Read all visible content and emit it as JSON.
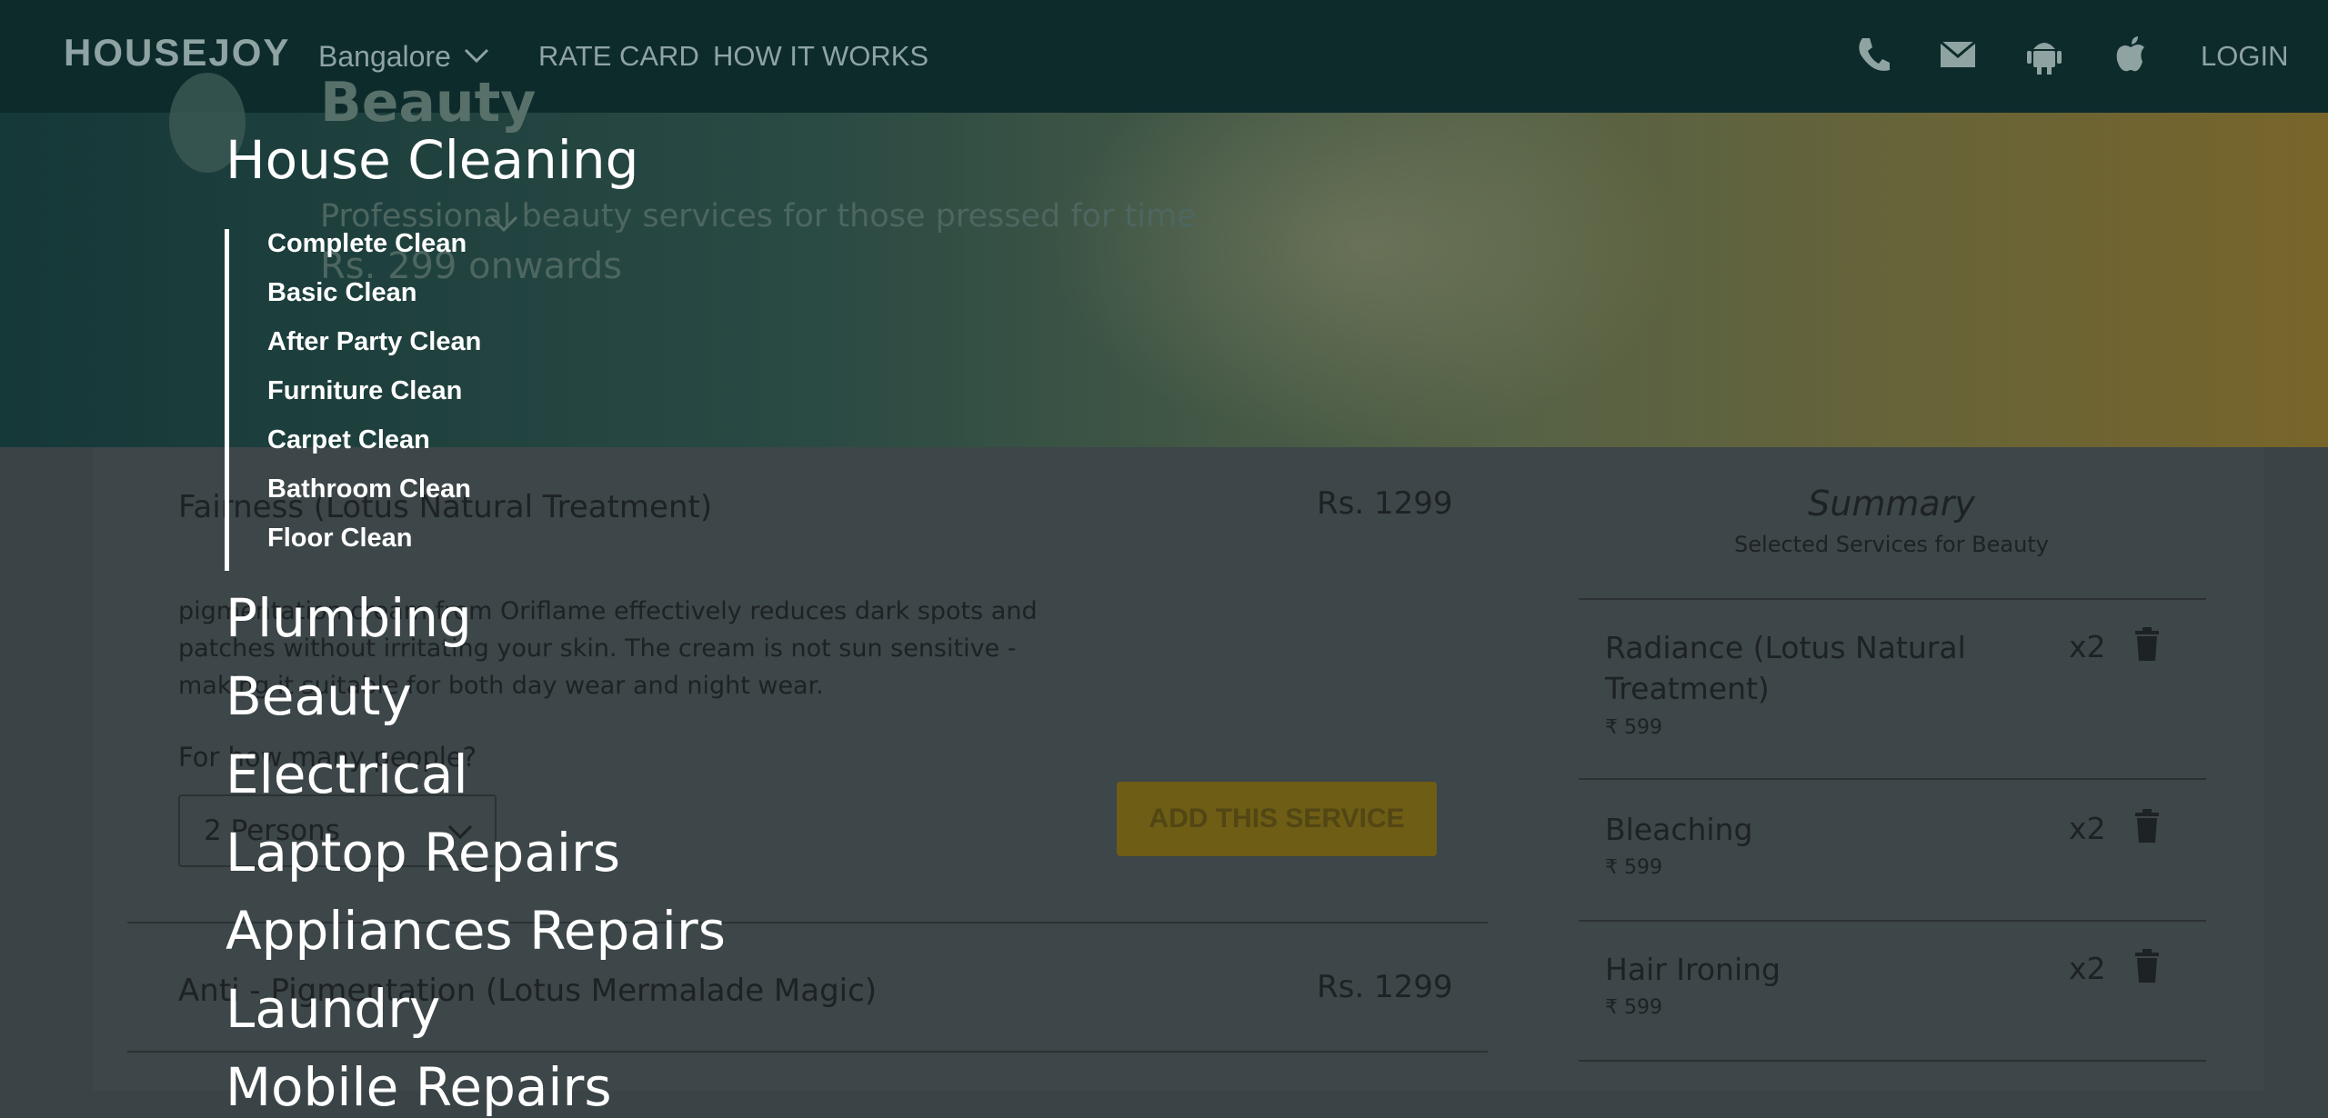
{
  "header": {
    "logo": "HOUSEJOY",
    "city": "Bangalore",
    "links": [
      "RATE CARD",
      "HOW IT WORKS"
    ],
    "icons": [
      "phone-icon",
      "mail-icon",
      "android-icon",
      "apple-icon"
    ],
    "login": "LOGIN"
  },
  "hero": {
    "title": "Beauty",
    "subtitle": "Professional beauty services for those pressed for time",
    "price": "Rs. 299 onwards"
  },
  "services": [
    {
      "title": "Fairness (Lotus Natural Treatment)",
      "price": "Rs. 1299",
      "description": "pigmentation cream from Oriflame effectively reduces dark spots and patches without irritating your skin. The cream is not sun sensitive - making it suitable for both day wear and night wear.",
      "persons_label": "For how many people?",
      "persons_value": "2 Persons",
      "add_button": "ADD THIS SERVICE"
    },
    {
      "title": "Anti - Pigmentation (Lotus Mermalade Magic)",
      "price": "Rs. 1299"
    }
  ],
  "summary": {
    "title": "Summary",
    "subtitle": "Selected Services for Beauty",
    "items": [
      {
        "name_line1": "Radiance (Lotus Natural",
        "name_line2": "Treatment)",
        "price": "₹ 599",
        "qty": "x2"
      },
      {
        "name_line1": "Bleaching",
        "name_line2": "",
        "price": "₹ 599",
        "qty": "x2"
      },
      {
        "name_line1": "Hair Ironing",
        "name_line2": "",
        "price": "₹ 599",
        "qty": "x2"
      }
    ]
  },
  "menu": {
    "categories": [
      "House Cleaning",
      "Plumbing",
      "Beauty",
      "Electrical",
      "Laptop Repairs",
      "Appliances Repairs",
      "Laundry",
      "Mobile Repairs"
    ],
    "house_cleaning_items": [
      "Complete Clean",
      "Basic Clean",
      "After Party Clean",
      "Furniture Clean",
      "Carpet Clean",
      "Bathroom Clean",
      "Floor Clean"
    ]
  },
  "colors": {
    "overlay": "#000000",
    "accent": "#f0c419",
    "navbar": "#0d2b2b"
  }
}
